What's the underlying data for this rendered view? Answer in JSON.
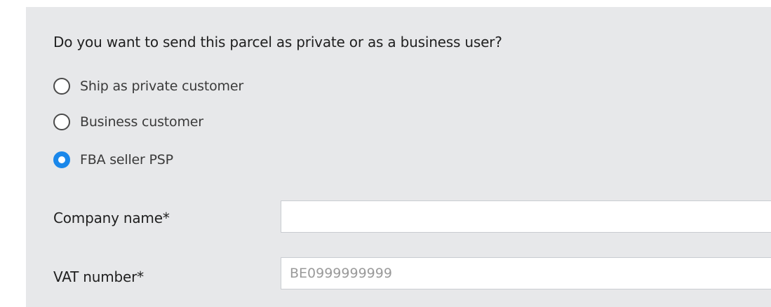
{
  "question": "Do you want to send this parcel as private or as a business user?",
  "options": [
    {
      "label": "Ship as private customer",
      "selected": false
    },
    {
      "label": "Business customer",
      "selected": false
    },
    {
      "label": "FBA seller PSP",
      "selected": true
    }
  ],
  "fields": {
    "company_name": {
      "label": "Company name*",
      "value": "",
      "placeholder": ""
    },
    "vat_number": {
      "label": "VAT number*",
      "value": "",
      "placeholder": "BE0999999999"
    }
  },
  "colors": {
    "panel_background": "#e7e8ea",
    "accent": "#1a87ea"
  }
}
